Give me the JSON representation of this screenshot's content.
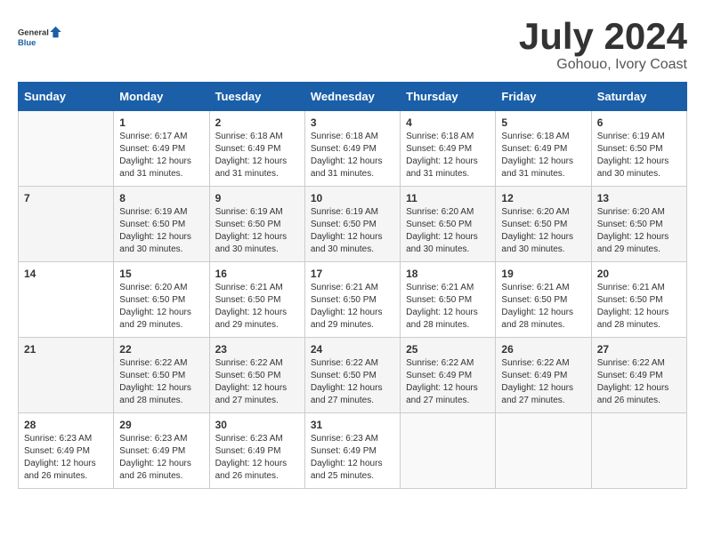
{
  "header": {
    "logo_general": "General",
    "logo_blue": "Blue",
    "month_title": "July 2024",
    "location": "Gohouo, Ivory Coast"
  },
  "calendar": {
    "days_of_week": [
      "Sunday",
      "Monday",
      "Tuesday",
      "Wednesday",
      "Thursday",
      "Friday",
      "Saturday"
    ],
    "weeks": [
      [
        {
          "day": "",
          "info": ""
        },
        {
          "day": "1",
          "info": "Sunrise: 6:17 AM\nSunset: 6:49 PM\nDaylight: 12 hours\nand 31 minutes."
        },
        {
          "day": "2",
          "info": "Sunrise: 6:18 AM\nSunset: 6:49 PM\nDaylight: 12 hours\nand 31 minutes."
        },
        {
          "day": "3",
          "info": "Sunrise: 6:18 AM\nSunset: 6:49 PM\nDaylight: 12 hours\nand 31 minutes."
        },
        {
          "day": "4",
          "info": "Sunrise: 6:18 AM\nSunset: 6:49 PM\nDaylight: 12 hours\nand 31 minutes."
        },
        {
          "day": "5",
          "info": "Sunrise: 6:18 AM\nSunset: 6:49 PM\nDaylight: 12 hours\nand 31 minutes."
        },
        {
          "day": "6",
          "info": "Sunrise: 6:19 AM\nSunset: 6:50 PM\nDaylight: 12 hours\nand 30 minutes."
        }
      ],
      [
        {
          "day": "7",
          "info": ""
        },
        {
          "day": "8",
          "info": "Sunrise: 6:19 AM\nSunset: 6:50 PM\nDaylight: 12 hours\nand 30 minutes."
        },
        {
          "day": "9",
          "info": "Sunrise: 6:19 AM\nSunset: 6:50 PM\nDaylight: 12 hours\nand 30 minutes."
        },
        {
          "day": "10",
          "info": "Sunrise: 6:19 AM\nSunset: 6:50 PM\nDaylight: 12 hours\nand 30 minutes."
        },
        {
          "day": "11",
          "info": "Sunrise: 6:20 AM\nSunset: 6:50 PM\nDaylight: 12 hours\nand 30 minutes."
        },
        {
          "day": "12",
          "info": "Sunrise: 6:20 AM\nSunset: 6:50 PM\nDaylight: 12 hours\nand 30 minutes."
        },
        {
          "day": "13",
          "info": "Sunrise: 6:20 AM\nSunset: 6:50 PM\nDaylight: 12 hours\nand 29 minutes."
        }
      ],
      [
        {
          "day": "14",
          "info": ""
        },
        {
          "day": "15",
          "info": "Sunrise: 6:20 AM\nSunset: 6:50 PM\nDaylight: 12 hours\nand 29 minutes."
        },
        {
          "day": "16",
          "info": "Sunrise: 6:21 AM\nSunset: 6:50 PM\nDaylight: 12 hours\nand 29 minutes."
        },
        {
          "day": "17",
          "info": "Sunrise: 6:21 AM\nSunset: 6:50 PM\nDaylight: 12 hours\nand 29 minutes."
        },
        {
          "day": "18",
          "info": "Sunrise: 6:21 AM\nSunset: 6:50 PM\nDaylight: 12 hours\nand 28 minutes."
        },
        {
          "day": "19",
          "info": "Sunrise: 6:21 AM\nSunset: 6:50 PM\nDaylight: 12 hours\nand 28 minutes."
        },
        {
          "day": "20",
          "info": "Sunrise: 6:21 AM\nSunset: 6:50 PM\nDaylight: 12 hours\nand 28 minutes."
        }
      ],
      [
        {
          "day": "21",
          "info": ""
        },
        {
          "day": "22",
          "info": "Sunrise: 6:22 AM\nSunset: 6:50 PM\nDaylight: 12 hours\nand 28 minutes."
        },
        {
          "day": "23",
          "info": "Sunrise: 6:22 AM\nSunset: 6:50 PM\nDaylight: 12 hours\nand 27 minutes."
        },
        {
          "day": "24",
          "info": "Sunrise: 6:22 AM\nSunset: 6:50 PM\nDaylight: 12 hours\nand 27 minutes."
        },
        {
          "day": "25",
          "info": "Sunrise: 6:22 AM\nSunset: 6:49 PM\nDaylight: 12 hours\nand 27 minutes."
        },
        {
          "day": "26",
          "info": "Sunrise: 6:22 AM\nSunset: 6:49 PM\nDaylight: 12 hours\nand 27 minutes."
        },
        {
          "day": "27",
          "info": "Sunrise: 6:22 AM\nSunset: 6:49 PM\nDaylight: 12 hours\nand 26 minutes."
        }
      ],
      [
        {
          "day": "28",
          "info": "Sunrise: 6:23 AM\nSunset: 6:49 PM\nDaylight: 12 hours\nand 26 minutes."
        },
        {
          "day": "29",
          "info": "Sunrise: 6:23 AM\nSunset: 6:49 PM\nDaylight: 12 hours\nand 26 minutes."
        },
        {
          "day": "30",
          "info": "Sunrise: 6:23 AM\nSunset: 6:49 PM\nDaylight: 12 hours\nand 26 minutes."
        },
        {
          "day": "31",
          "info": "Sunrise: 6:23 AM\nSunset: 6:49 PM\nDaylight: 12 hours\nand 25 minutes."
        },
        {
          "day": "",
          "info": ""
        },
        {
          "day": "",
          "info": ""
        },
        {
          "day": "",
          "info": ""
        }
      ]
    ]
  }
}
